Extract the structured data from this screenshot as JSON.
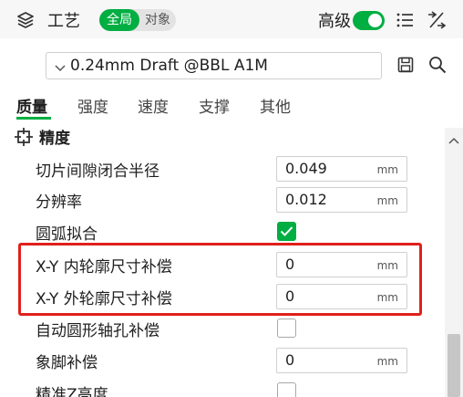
{
  "header": {
    "title": "工艺",
    "scope_global": "全局",
    "scope_object": "对象",
    "advanced_label": "高级",
    "advanced_on": true
  },
  "preset": {
    "name": "0.24mm Draft @BBL A1M"
  },
  "tabs": [
    {
      "label": "质量",
      "active": true
    },
    {
      "label": "强度",
      "active": false
    },
    {
      "label": "速度",
      "active": false
    },
    {
      "label": "支撑",
      "active": false
    },
    {
      "label": "其他",
      "active": false
    }
  ],
  "section": {
    "title": "精度"
  },
  "settings": [
    {
      "label": "切片间隙闭合半径",
      "type": "number",
      "value": "0.049",
      "unit": "mm"
    },
    {
      "label": "分辨率",
      "type": "number",
      "value": "0.012",
      "unit": "mm"
    },
    {
      "label": "圆弧拟合",
      "type": "checkbox",
      "checked": true
    },
    {
      "label": "X-Y 内轮廓尺寸补偿",
      "type": "number",
      "value": "0",
      "unit": "mm"
    },
    {
      "label": "X-Y 外轮廓尺寸补偿",
      "type": "number",
      "value": "0",
      "unit": "mm"
    },
    {
      "label": "自动圆形轴孔补偿",
      "type": "checkbox",
      "checked": false
    },
    {
      "label": "象脚补偿",
      "type": "number",
      "value": "0",
      "unit": "mm"
    },
    {
      "label": "精准Z高度",
      "type": "checkbox",
      "checked": false
    }
  ],
  "colors": {
    "accent": "#00ae42",
    "highlight": "#e0201b"
  }
}
